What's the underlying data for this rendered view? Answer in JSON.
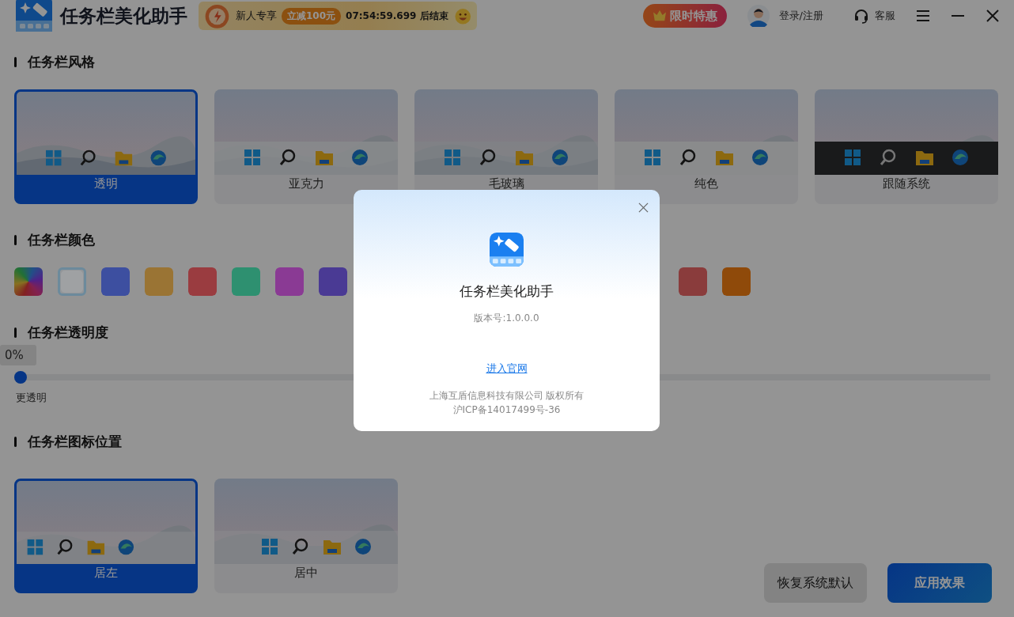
{
  "app": {
    "title": "任务栏美化助手"
  },
  "promo": {
    "label": "新人专享",
    "discount": "立减100元",
    "countdown": "07:54:59.699 后结束"
  },
  "header": {
    "deal": "限时特惠",
    "login": "登录/注册",
    "support": "客服"
  },
  "style_section": {
    "title": "任务栏风格",
    "cards": [
      {
        "label": "透明",
        "kind": "transparent",
        "selected": true
      },
      {
        "label": "亚克力",
        "kind": "acrylic",
        "selected": false
      },
      {
        "label": "毛玻璃",
        "kind": "frosted",
        "selected": false
      },
      {
        "label": "纯色",
        "kind": "solid",
        "selected": false
      },
      {
        "label": "跟随系统",
        "kind": "dark",
        "selected": false
      }
    ]
  },
  "color_section": {
    "title": "任务栏颜色",
    "swatches": [
      {
        "kind": "gradient",
        "selected": false
      },
      {
        "kind": "plain",
        "color": "#9fa1a3",
        "selected": true
      },
      {
        "kind": "plain",
        "color": "#3d4fa0",
        "selected": false
      },
      {
        "kind": "plain",
        "color": "#9a7434",
        "selected": false
      },
      {
        "kind": "plain",
        "color": "#9a3c40",
        "selected": false
      },
      {
        "kind": "plain",
        "color": "#2e9070",
        "selected": false
      },
      {
        "kind": "plain",
        "color": "#8a3a94",
        "selected": false
      },
      {
        "kind": "plain",
        "color": "#4a3a94",
        "selected": false
      },
      {
        "kind": "plain",
        "color": "#8a3c3c",
        "selected": false
      },
      {
        "kind": "plain",
        "color": "#8f4a0a",
        "selected": false
      }
    ]
  },
  "opacity_section": {
    "title": "任务栏透明度",
    "value": "0%",
    "level": 0,
    "min_label": "更透明"
  },
  "position_section": {
    "title": "任务栏图标位置",
    "cards": [
      {
        "label": "居左",
        "kind": "left",
        "selected": true
      },
      {
        "label": "居中",
        "kind": "center",
        "selected": false
      }
    ]
  },
  "buttons": [
    {
      "label": "恢复系统默认",
      "kind": "secondary"
    },
    {
      "label": "应用效果",
      "kind": "primary"
    }
  ],
  "dialog": {
    "name": "任务栏美化助手",
    "version": "版本号:1.0.0.0",
    "link": "进入官网",
    "copyright": "上海互盾信息科技有限公司 版权所有",
    "icp": "沪ICP备14017499号-36"
  }
}
